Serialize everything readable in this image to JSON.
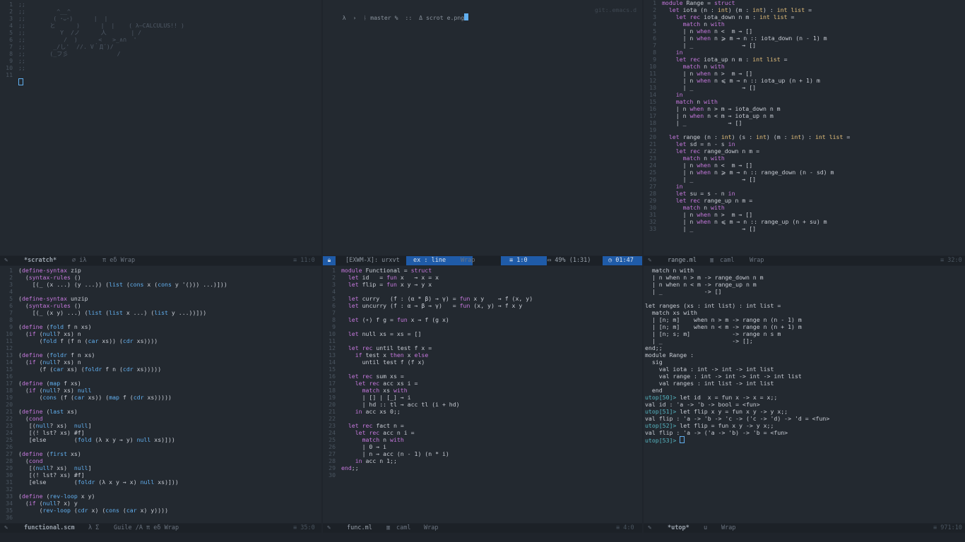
{
  "colors": {
    "bg": "#1f242b",
    "pane": "#232930",
    "modeline": "#1c2127",
    "modeline_active": "#1f5ba8",
    "accent": "#61afef",
    "text": "#c8ccd4",
    "dim": "#6b7480"
  },
  "scratch": {
    "lines": [
      ";;",
      ";;         ^__^",
      ";;        ( ･ᴗ･)      |  |",
      ";;       と      )      |  |    ( λ—CALCULUS!! )",
      ";;          Y  /ノ      人       | /",
      ";;           /  )      <   >_∧∩  '",
      ";;        _/し'  //. V｀Д´)/",
      ";;       (_フ彡              /",
      ";;",
      ";;",
      ""
    ],
    "line_numbers": [
      "1",
      "2",
      "3",
      "4",
      "5",
      "6",
      "7",
      "8",
      "9",
      "10",
      "11"
    ],
    "modeline": {
      "icon": "✎",
      "buffer": "*scratch*",
      "mode_icon": "∅ iλ",
      "mode": "π eδ Wrap",
      "pos": "≡ 11:0"
    }
  },
  "terminal": {
    "prompt": "λ  ›  ᚿ master %  ::  Δ scrot e.png",
    "right": "git:.emacs.d",
    "modeline": {
      "icon": "🔒",
      "buffer": "[EXWM-X]: urxvt",
      "mode": "ex : line",
      "wrap": "Wrap",
      "pos": "≡ 1:0",
      "battery": "▭ 49% (1:31)",
      "clock": "◷ 01:47"
    }
  },
  "range_ml": {
    "line_numbers": [
      "1",
      "2",
      "3",
      "4",
      "5",
      "6",
      "7",
      "8",
      "9",
      "10",
      "11",
      "12",
      "13",
      "14",
      "15",
      "16",
      "17",
      "18",
      "19",
      "20",
      "21",
      "22",
      "23",
      "24",
      "25",
      "26",
      "27",
      "28",
      "29",
      "30",
      "31",
      "32",
      "33"
    ],
    "lines": [
      "module Range = struct",
      "  let iota (n : int) (m : int) : int list =",
      "    let rec iota_down n m : int list =",
      "      match n with",
      "      | n when n <  m → []",
      "      | n when n ⩾ m → n :: iota_down (n - 1) m",
      "      | _              → []",
      "    in",
      "    let rec iota_up n m : int list =",
      "      match n with",
      "      | n when n >  m → []",
      "      | n when n ⩽ m → n :: iota_up (n + 1) m",
      "      | _              → []",
      "    in",
      "    match n with",
      "    | n when n > m → iota_down n m",
      "    | n when n < m → iota_up n m",
      "    | _            → []",
      "",
      "  let range (n : int) (s : int) (m : int) : int list =",
      "    let sd = n - s in",
      "    let rec range_down n m =",
      "      match n with",
      "      | n when n <  m → []",
      "      | n when n ⩾ m → n :: range_down (n - sd) m",
      "      | _              → []",
      "    in",
      "    let su = s - n in",
      "    let rec range_up n m =",
      "      match n with",
      "      | n when n >  m → []",
      "      | n when n ⩽ m → n :: range_up (n + su) m",
      "      | _              → []"
    ],
    "modeline": {
      "icon": "✎",
      "buffer": "range.ml",
      "mode_icon": "▥",
      "mode": "caml",
      "wrap": "Wrap",
      "pos": "≡ 32:0"
    }
  },
  "functional_scm": {
    "line_numbers": [
      "1",
      "2",
      "3",
      "4",
      "5",
      "6",
      "7",
      "8",
      "9",
      "10",
      "11",
      "12",
      "13",
      "14",
      "15",
      "16",
      "17",
      "18",
      "19",
      "20",
      "21",
      "22",
      "23",
      "24",
      "25",
      "26",
      "27",
      "28",
      "29",
      "30",
      "31",
      "32",
      "33",
      "34",
      "35",
      "36"
    ],
    "lines": [
      "(define-syntax zip",
      "  (syntax-rules ()",
      "    [(_ (x ...) (y ...)) (list (cons x (cons y '())) ...)]))",
      "",
      "(define-syntax unzip",
      "  (syntax-rules ()",
      "    [(_ (x y) ...) (list (list x ...) (list y ...))]))",
      "",
      "(define (fold f n xs)",
      "  (if (null? xs) n",
      "      (fold f (f n (car xs)) (cdr xs))))",
      "",
      "(define (foldr f n xs)",
      "  (if (null? xs) n",
      "      (f (car xs) (foldr f n (cdr xs)))))",
      "",
      "(define (map f xs)",
      "  (if (null? xs) null",
      "      (cons (f (car xs)) (map f (cdr xs)))))",
      "",
      "(define (last xs)",
      "  (cond",
      "   [(null? xs)  null]",
      "   [(! lst? xs) #f]",
      "   [else        (fold (λ x y → y) null xs)]))",
      "",
      "(define (first xs)",
      "  (cond",
      "   [(null? xs)  null]",
      "   [(! lst? xs) #f]",
      "   [else        (foldr (λ x y → x) null xs)]))",
      "",
      "(define (rev-loop x y)",
      "  (if (null? x) y",
      "      (rev-loop (cdr x) (cons (car x) y))))",
      ""
    ],
    "modeline": {
      "icon": "✎",
      "buffer": "functional.scm",
      "mode_icon": "λ Σ",
      "mode": "Guile /A π eδ Wrap",
      "pos": "≡ 35:0"
    }
  },
  "func_ml": {
    "line_numbers": [
      "1",
      "2",
      "3",
      "4",
      "5",
      "6",
      "7",
      "8",
      "9",
      "10",
      "11",
      "12",
      "13",
      "14",
      "15",
      "16",
      "17",
      "18",
      "19",
      "20",
      "21",
      "22",
      "23",
      "24",
      "25",
      "26",
      "27",
      "28",
      "29",
      "30"
    ],
    "lines": [
      "module Functional = struct",
      "  let id   = fun x   → x = x",
      "  let flip = fun x y → y x",
      "",
      "  let curry   (f : (α * β) → γ) = fun x y    → f (x, y)",
      "  let uncurry (f : α → β → γ)   = fun (x, y) → f x y",
      "",
      "  let (∘) f g = fun x → f (g x)",
      "",
      "  let null xs = xs = []",
      "",
      "  let rec until test f x =",
      "    if test x then x else",
      "      until test f (f x)",
      "",
      "  let rec sum xs =",
      "    let rec acc xs i =",
      "      match xs with",
      "      | [] | [_] → i",
      "      | hd :: tl → acc tl (i + hd)",
      "    in acc xs 0;;",
      "",
      "  let rec fact n =",
      "    let rec acc n i =",
      "      match n with",
      "      | 0 → i",
      "      | n → acc (n - 1) (n * i)",
      "    in acc n 1;;",
      "end;;",
      ""
    ],
    "modeline": {
      "icon": "✎",
      "buffer": "func.ml",
      "mode_icon": "▥",
      "mode": "caml",
      "wrap": "Wrap",
      "pos": "≡ 4:0"
    }
  },
  "utop": {
    "lines": [
      "  match n with",
      "  | n when n > m -> range_down n m",
      "  | n when n < m -> range_up n m",
      "  | _            -> []",
      "",
      "let ranges (xs : int list) : int list =",
      "  match xs with",
      "  | [n; m]    when n > m -> range n (n - 1) m",
      "  | [n; m]    when n < m -> range n (n + 1) m",
      "  | [n; s; m]            -> range n s m",
      "  | _                    -> [];",
      "end;;",
      "module Range :",
      "  sig",
      "    val iota : int -> int -> int list",
      "    val range : int -> int -> int -> int list",
      "    val ranges : int list -> int list",
      "  end",
      "utop[50]> let id  x = fun x -> x = x;;",
      "val id : 'a -> 'b -> bool = <fun>",
      "utop[51]> let flip x y = fun x y -> y x;;",
      "val flip : 'a -> 'b -> 'c -> ('c -> 'd) -> 'd = <fun>",
      "utop[52]> let flip = fun x y -> y x;;",
      "val flip : 'a -> ('a -> 'b) -> 'b = <fun>",
      "utop[53]> "
    ],
    "modeline": {
      "icon": "✎",
      "buffer": "*utop*",
      "mode_icon": "u",
      "wrap": "Wrap",
      "pos": "≡ 971:10"
    }
  }
}
